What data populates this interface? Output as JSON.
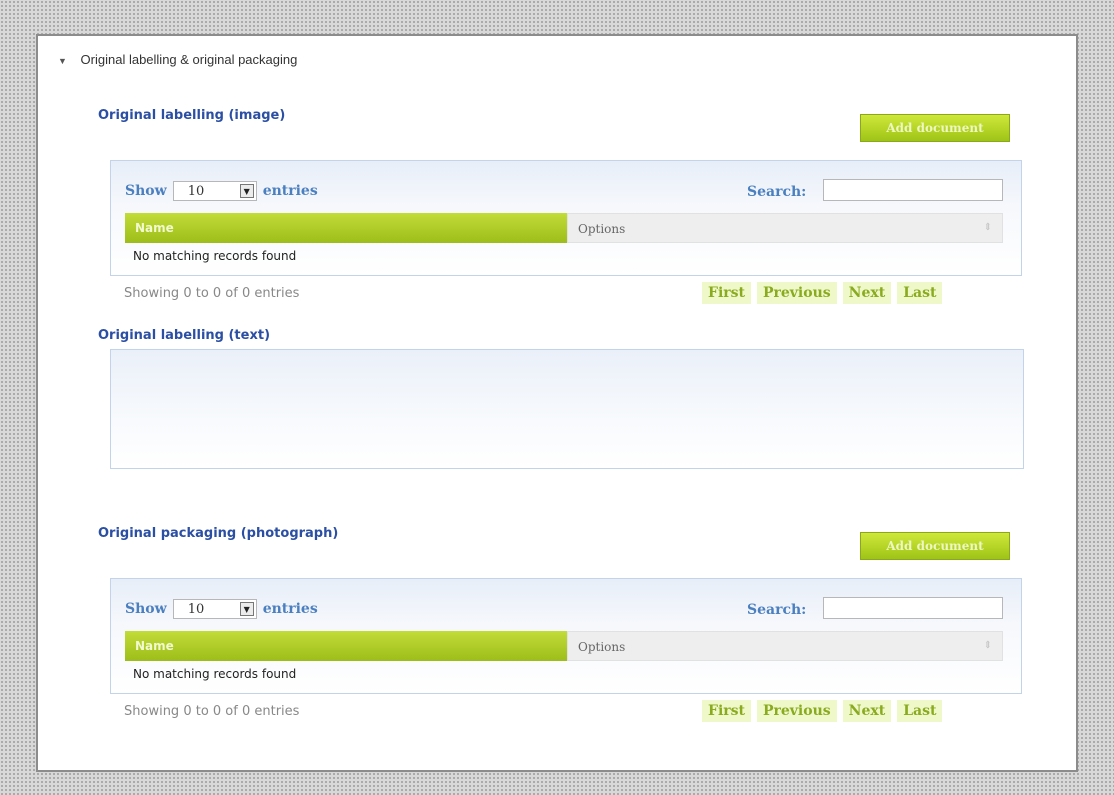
{
  "section": {
    "toggle_icon": "collapse-triangle-icon",
    "title": "Original labelling & original packaging"
  },
  "image_section": {
    "title": "Original labelling (image)",
    "add_label": "Add document",
    "show_label": "Show",
    "page_size": "10",
    "entries_label": "entries",
    "search_label": "Search:",
    "search_value": "",
    "columns": [
      "Name",
      "Options"
    ],
    "empty_text": "No matching records found",
    "info_text": "Showing 0 to 0 of 0 entries",
    "pager": [
      "First",
      "Previous",
      "Next",
      "Last"
    ]
  },
  "text_section": {
    "title": "Original labelling (text)",
    "value": ""
  },
  "packaging_section": {
    "title": "Original packaging (photograph)",
    "add_label": "Add document",
    "show_label": "Show",
    "page_size": "10",
    "entries_label": "entries",
    "search_label": "Search:",
    "search_value": "",
    "columns": [
      "Name",
      "Options"
    ],
    "empty_text": "No matching records found",
    "info_text": "Showing 0 to 0 of 0 entries",
    "pager": [
      "First",
      "Previous",
      "Next",
      "Last"
    ]
  },
  "colors": {
    "accent_green": "#a8cc1c",
    "title_blue": "#2b4fa3",
    "link_blue": "#4a7fc0"
  }
}
